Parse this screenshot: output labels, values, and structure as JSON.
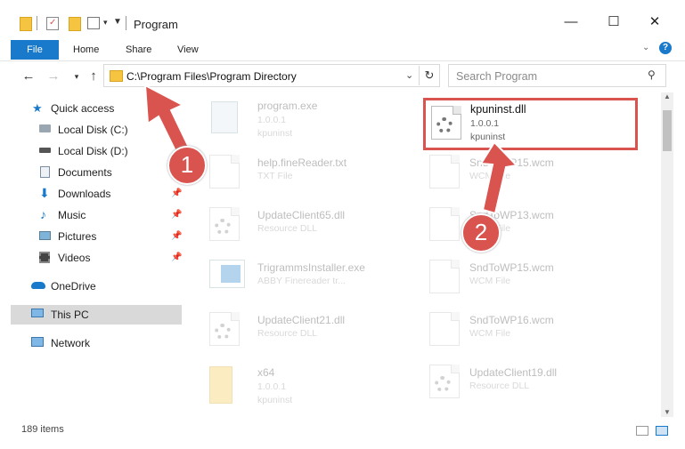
{
  "window": {
    "title": "Program",
    "minimize": "—",
    "maximize": "☐",
    "close": "✕"
  },
  "ribbon": {
    "tabs": [
      "File",
      "Home",
      "Share",
      "View"
    ]
  },
  "address": {
    "path": "C:\\Program Files\\Program Directory",
    "search_placeholder": "Search Program"
  },
  "nav": {
    "quick_access": "Quick access",
    "items": [
      "Local Disk (C:)",
      "Local Disk (D:)",
      "Documents",
      "Downloads",
      "Music",
      "Pictures",
      "Videos"
    ],
    "onedrive": "OneDrive",
    "this_pc": "This PC",
    "network": "Network"
  },
  "files_left": [
    {
      "name": "program.exe",
      "line1": "1.0.0.1",
      "line2": "kpuninst"
    },
    {
      "name": "help.fineReader.txt",
      "line1": "TXT File"
    },
    {
      "name": "UpdateClient65.dll",
      "line1": "Resource DLL"
    },
    {
      "name": "TrigrammsInstaller.exe",
      "line1": "ABBY Finereader tr..."
    },
    {
      "name": "UpdateClient21.dll",
      "line1": "Resource DLL"
    },
    {
      "name": "x64",
      "line1": "1.0.0.1",
      "line2": "kpuninst"
    }
  ],
  "files_right": [
    {
      "name": "kpuninst.dll",
      "line1": "1.0.0.1",
      "line2": "kpuninst"
    },
    {
      "name": "SndToWP15.wcm",
      "line1": "WCM File"
    },
    {
      "name": "SndToWP13.wcm",
      "line1": "WCM File"
    },
    {
      "name": "SndToWP15.wcm",
      "line1": "WCM File"
    },
    {
      "name": "SndToWP16.wcm",
      "line1": "WCM File"
    },
    {
      "name": "UpdateClient19.dll",
      "line1": "Resource DLL"
    }
  ],
  "status": {
    "count": "189 items"
  },
  "annotations": {
    "badge1": "1",
    "badge2": "2",
    "color": "#d9534f"
  }
}
